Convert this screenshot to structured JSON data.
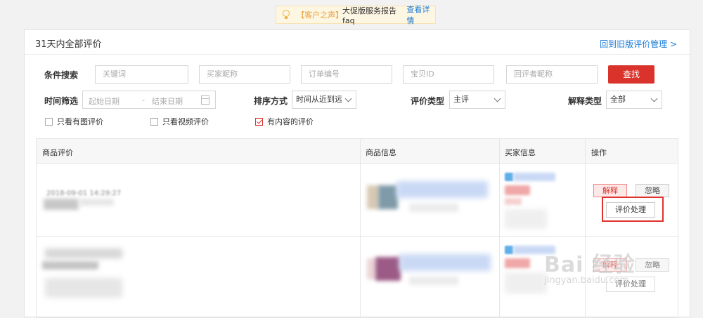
{
  "notice": {
    "tag": "【客户之声】",
    "text": "大促版服务报告faq",
    "link": "查看详情"
  },
  "header": {
    "title": "31天内全部评价",
    "old_link": "回到旧版评价管理 >"
  },
  "filters": {
    "search_label": "条件搜索",
    "keyword_placeholder": "关键词",
    "buyer_placeholder": "买家昵称",
    "order_placeholder": "订单编号",
    "item_placeholder": "宝贝ID",
    "reviewer_placeholder": "回评者昵称",
    "search_button": "查找",
    "time_label": "时间筛选",
    "start_placeholder": "起始日期",
    "date_sep": "-",
    "end_placeholder": "结束日期",
    "sort_label": "排序方式",
    "sort_value": "时间从近到远",
    "type_label": "评价类型",
    "type_value": "主评",
    "explain_label": "解释类型",
    "explain_value": "全部",
    "check_image": "只看有图评价",
    "check_video": "只看视频评价",
    "check_content": "有内容的评价"
  },
  "table": {
    "headers": [
      "商品评价",
      "商品信息",
      "买家信息",
      "操作"
    ],
    "row1": {
      "time": "2018-09-01 14:29:27",
      "btn_explain": "解释",
      "btn_ignore": "忽略",
      "btn_handle": "评价处理"
    },
    "row2": {
      "btn_explain": "解释",
      "btn_ignore": "忽略",
      "btn_handle": "评价处理"
    }
  },
  "watermark": {
    "main": "Bai 经验",
    "sub": "jingyan.baidu.com"
  },
  "colors": {
    "accent": "#d9332c",
    "link": "#1a7bd9",
    "highlight": "#e0322c"
  }
}
